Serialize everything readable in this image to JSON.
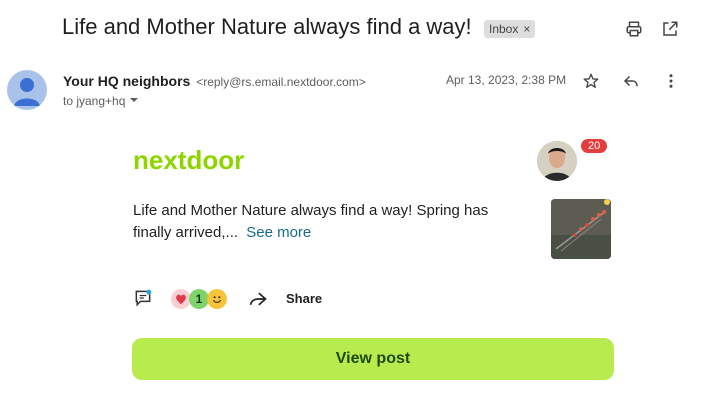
{
  "email": {
    "subject": "Life and Mother Nature always find a way!",
    "label_chip": "Inbox",
    "label_remove": "×",
    "sender_name": "Your HQ neighbors",
    "sender_email": "<reply@rs.email.nextdoor.com>",
    "recipient": "to jyang+hq",
    "date": "Apr 13, 2023, 2:38 PM"
  },
  "post": {
    "brand": "nextdoor",
    "notification_count": "20",
    "text": "Life and Mother Nature always find a way! Spring has finally arrived,...",
    "see_more": "See more",
    "reaction_count": "1",
    "share_label": "Share",
    "cta_label": "View post"
  },
  "colors": {
    "brand_green": "#8ed500",
    "cta_bg": "#b8eb4e",
    "badge_red": "#e33d3d",
    "link": "#1a6a8a"
  },
  "icons": [
    "print-icon",
    "open-in-new-icon",
    "star-icon",
    "reply-icon",
    "more-vert-icon",
    "chevron-down-icon",
    "comment-icon",
    "heart-icon",
    "thumbs-up-icon",
    "smile-icon",
    "share-icon"
  ]
}
